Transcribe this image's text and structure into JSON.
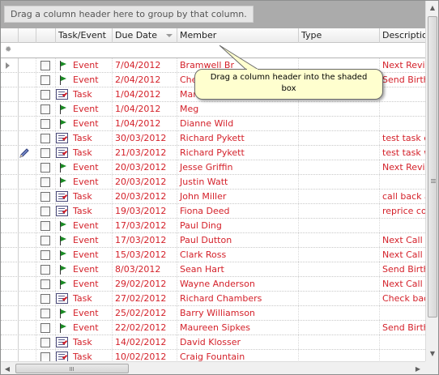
{
  "group_panel": {
    "hint": "Drag a column header here to group by that column."
  },
  "columns": [
    "Task/Event",
    "Due Date",
    "Member",
    "Type",
    "Description"
  ],
  "new_row_marker": "✹",
  "tooltip": {
    "text": "Drag a column header into the shaded box"
  },
  "rows": [
    {
      "type": "Event",
      "due": "7/04/2012",
      "member": "Bramwell Br",
      "desc": "Next Revie",
      "current": true
    },
    {
      "type": "Event",
      "due": "2/04/2012",
      "member": "Che",
      "desc": "Send Birthc"
    },
    {
      "type": "Task",
      "due": "1/04/2012",
      "member": "Mar",
      "desc": ""
    },
    {
      "type": "Event",
      "due": "1/04/2012",
      "member": "Meg",
      "desc": ""
    },
    {
      "type": "Event",
      "due": "1/04/2012",
      "member": "Dianne Wild",
      "desc": ""
    },
    {
      "type": "Task",
      "due": "30/03/2012",
      "member": "Richard Pykett",
      "desc": "test task er"
    },
    {
      "type": "Task",
      "due": "21/03/2012",
      "member": "Richard Pykett",
      "desc": "test task wi",
      "attachment": true
    },
    {
      "type": "Event",
      "due": "20/03/2012",
      "member": "Jesse Griffin",
      "desc": "Next Revie"
    },
    {
      "type": "Event",
      "due": "20/03/2012",
      "member": "Justin Watt",
      "desc": ""
    },
    {
      "type": "Task",
      "due": "20/03/2012",
      "member": "John Miller",
      "desc": "call back a"
    },
    {
      "type": "Task",
      "due": "19/03/2012",
      "member": "Fiona Deed",
      "desc": "reprice cov"
    },
    {
      "type": "Event",
      "due": "17/03/2012",
      "member": "Paul Ding",
      "desc": ""
    },
    {
      "type": "Event",
      "due": "17/03/2012",
      "member": "Paul Dutton",
      "desc": "Next Call"
    },
    {
      "type": "Event",
      "due": "15/03/2012",
      "member": "Clark Ross",
      "desc": "Next Call"
    },
    {
      "type": "Event",
      "due": "8/03/2012",
      "member": "Sean Hart",
      "desc": "Send Birthc"
    },
    {
      "type": "Event",
      "due": "29/02/2012",
      "member": "Wayne Anderson",
      "desc": "Next Call"
    },
    {
      "type": "Task",
      "due": "27/02/2012",
      "member": "Richard Chambers",
      "desc": "Check bac"
    },
    {
      "type": "Event",
      "due": "25/02/2012",
      "member": "Barry Williamson",
      "desc": ""
    },
    {
      "type": "Event",
      "due": "22/02/2012",
      "member": "Maureen Sipkes",
      "desc": "Send Birthc"
    },
    {
      "type": "Task",
      "due": "14/02/2012",
      "member": "David Klosser",
      "desc": ""
    },
    {
      "type": "Task",
      "due": "10/02/2012",
      "member": "Craig Fountain",
      "desc": ""
    }
  ]
}
